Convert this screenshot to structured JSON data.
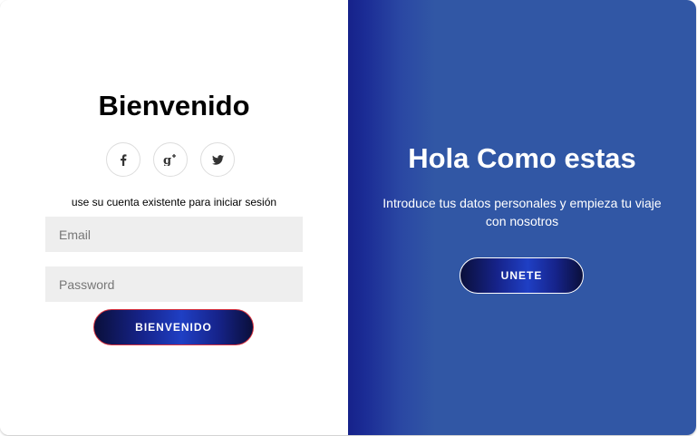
{
  "signin": {
    "title": "Bienvenido",
    "social": [
      {
        "icon": "facebook-icon",
        "glyph": "f"
      },
      {
        "icon": "google-plus-icon",
        "glyph": "g+"
      },
      {
        "icon": "twitter-icon",
        "glyph": "twitter"
      }
    ],
    "hint": "use su cuenta existente para iniciar sesión",
    "email_placeholder": "Email",
    "password_placeholder": "Password",
    "button_label": "BIENVENIDO"
  },
  "overlay": {
    "title": "Hola Como estas",
    "text": "Introduce tus datos personales y empieza tu viaje con nosotros",
    "button_label": "UNETE"
  },
  "colors": {
    "panel_blue": "#3157a5",
    "button_dark": "#0a0f3a",
    "button_mid": "#1f3fc4",
    "signin_button_border": "#d9333f",
    "input_bg": "#eeeeee"
  }
}
